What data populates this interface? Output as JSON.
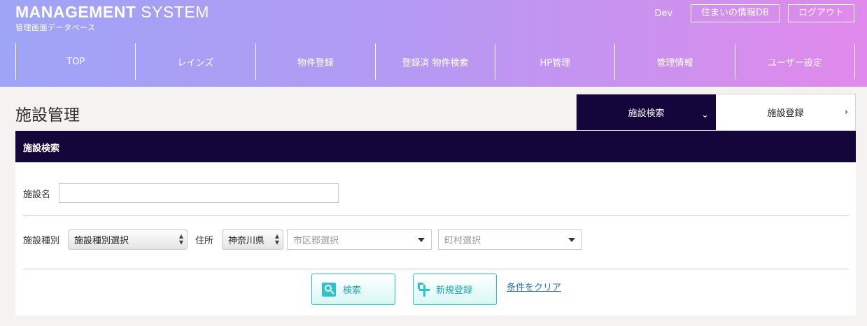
{
  "header": {
    "brand_bold": "MANAGEMENT",
    "brand_thin": "SYSTEM",
    "brand_sub": "管理画面データベース",
    "user": "Dev",
    "link_db": "住まいの情報DB",
    "logout": "ログアウト"
  },
  "nav": [
    {
      "label": "TOP"
    },
    {
      "label": "レインズ"
    },
    {
      "label": "物件登録"
    },
    {
      "label": "登録済 物件検索"
    },
    {
      "label": "HP管理"
    },
    {
      "label": "管理情報"
    },
    {
      "label": "ユーザー設定"
    }
  ],
  "page": {
    "title": "施設管理"
  },
  "tabs": {
    "search": {
      "label": "施設検索",
      "icon": "chevron-down-icon"
    },
    "register": {
      "label": "施設登録",
      "icon": "chevron-right-icon"
    }
  },
  "panel": {
    "heading": "施設検索",
    "facility_name_label": "施設名",
    "facility_name_value": "",
    "facility_type_label": "施設種別",
    "facility_type_value": "施設種別選択",
    "address_label": "住所",
    "prefecture_value": "神奈川県",
    "city_placeholder": "市区郡選択",
    "town_placeholder": "町村選択"
  },
  "actions": {
    "search": "検索",
    "new": "新規登録",
    "clear": "条件をクリア"
  },
  "colors": {
    "gradient_start": "#9ea4f6",
    "gradient_end": "#e189ec",
    "dark_navy": "#14063a",
    "accent_teal": "#2cc4c8",
    "link_blue": "#2a6fc4"
  }
}
